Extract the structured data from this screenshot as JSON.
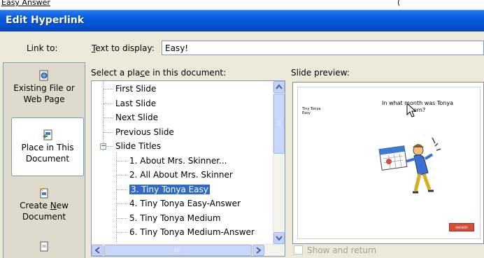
{
  "top_strip": {
    "shown_text": "Easy Answer",
    "paren": "("
  },
  "window": {
    "title": "Edit Hyperlink"
  },
  "link_to": {
    "label": "Link to:",
    "buttons": [
      {
        "label_line1": "Existing File or",
        "label_line2": "Web Page",
        "icon": "web-page-icon",
        "selected": false
      },
      {
        "label_line1": "Place in This",
        "label_line2": "Document",
        "icon": "place-in-document-icon",
        "selected": true
      },
      {
        "label_line1": "Create New",
        "label_line2": "Document",
        "icon": "new-document-icon",
        "selected": false
      },
      {
        "label_line1": "",
        "label_line2": "",
        "icon": "email-address-icon",
        "selected": false
      }
    ]
  },
  "text_to_display": {
    "label": "Text to display:",
    "value": "Easy!"
  },
  "place_tree": {
    "label": "Select a place in this document:",
    "items": [
      {
        "text": "First Slide",
        "level": 0
      },
      {
        "text": "Last Slide",
        "level": 0
      },
      {
        "text": "Next Slide",
        "level": 0
      },
      {
        "text": "Previous Slide",
        "level": 0
      },
      {
        "text": "Slide Titles",
        "level": 0,
        "expander": "−"
      },
      {
        "text": "1. About Mrs. Skinner...",
        "level": 1
      },
      {
        "text": "2. All About Mrs. Skinner",
        "level": 1
      },
      {
        "text": "3. Tiny Tonya Easy",
        "level": 1,
        "selected": true
      },
      {
        "text": "4. Tiny Tonya Easy-Answer",
        "level": 1
      },
      {
        "text": "5. Tiny Tonya Medium",
        "level": 1
      },
      {
        "text": "6. Tiny Tonya Medium-Answer",
        "level": 1
      }
    ]
  },
  "slide_preview": {
    "label": "Slide preview:",
    "small_title": "Tiny Tonya",
    "small_subtitle": "Easy",
    "question_line1": "In what month was Tonya",
    "question_line2": "born?",
    "answer_button": "ANSWER"
  },
  "show_and_return": {
    "label": "Show and return",
    "checked": false
  },
  "colors": {
    "title_bar": "#0553d4",
    "selection": "#316ac5",
    "answer_button": "#d84a3a"
  }
}
